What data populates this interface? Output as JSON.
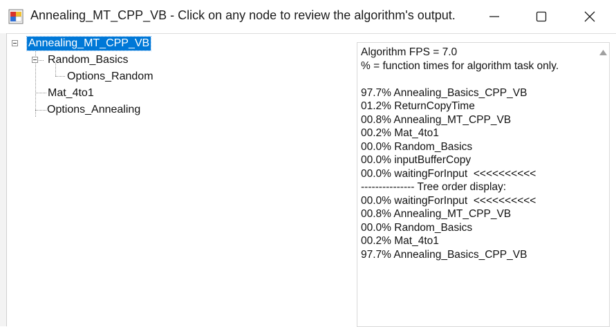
{
  "window": {
    "title": "Annealing_MT_CPP_VB - Click on any node to review the algorithm's output.",
    "minimize_icon": "minimize-icon",
    "maximize_icon": "maximize-icon",
    "close_icon": "close-icon"
  },
  "tree": {
    "root": "Annealing_MT_CPP_VB",
    "random_basics": "Random_Basics",
    "options_random": "Options_Random",
    "mat_4to1": "Mat_4to1",
    "options_annealing": "Options_Annealing",
    "selected": "Annealing_MT_CPP_VB"
  },
  "output": {
    "lines": [
      "Algorithm FPS = 7.0",
      "% = function times for algorithm task only.",
      "",
      "97.7% Annealing_Basics_CPP_VB",
      "01.2% ReturnCopyTime",
      "00.8% Annealing_MT_CPP_VB",
      "00.2% Mat_4to1",
      "00.0% Random_Basics",
      "00.0% inputBufferCopy",
      "00.0% waitingForInput  <<<<<<<<<<",
      "--------------- Tree order display:",
      "00.0% waitingForInput  <<<<<<<<<<",
      "00.8% Annealing_MT_CPP_VB",
      "00.0% Random_Basics",
      "00.2% Mat_4to1",
      "97.7% Annealing_Basics_CPP_VB"
    ]
  },
  "colors": {
    "selection": "#0078d7",
    "app_icon_red": "#d9342b",
    "app_icon_yellow": "#f2c12e",
    "app_icon_blue": "#2f6fd6"
  }
}
